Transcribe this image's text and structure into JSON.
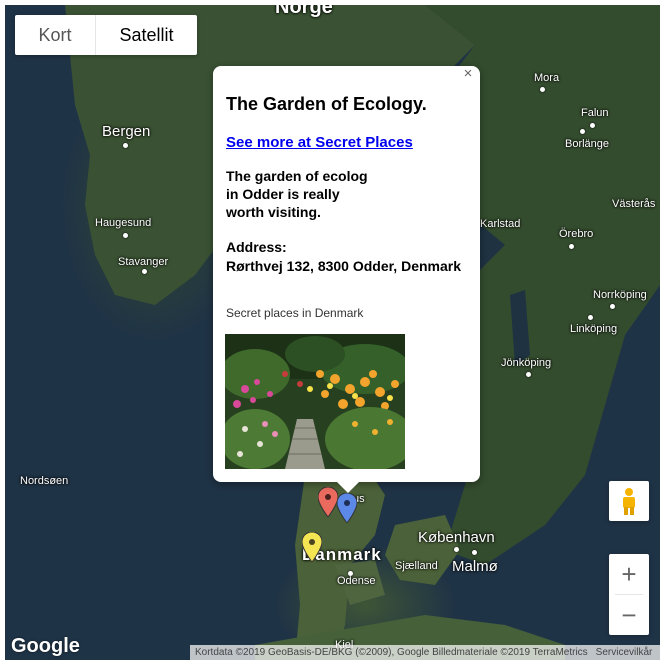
{
  "map_type": {
    "kort_label": "Kort",
    "satellite_label": "Satellit",
    "selected": "Satellit"
  },
  "map_labels": {
    "norge": "Norge",
    "bergen": "Bergen",
    "haugesund": "Haugesund",
    "stavanger": "Stavanger",
    "nordsoen": "Nordsøen",
    "mora": "Mora",
    "falun": "Falun",
    "borlange": "Borlänge",
    "vasteras": "Västerås",
    "karlstad": "Karlstad",
    "orebro": "Örebro",
    "norrkoping": "Norrköping",
    "linkoping": "Linköping",
    "jonkoping": "Jönköping",
    "aarhus": "us",
    "danmark": "Danmark",
    "kobenhavn": "København",
    "malmo": "Malmø",
    "sjaelland": "Sjælland",
    "odense": "Odense",
    "kiel": "Kiel"
  },
  "info_window": {
    "close_symbol": "×",
    "title": "The Garden of Ecology.",
    "link_text": "See more at Secret Places",
    "description": "The garden of ecolog\nin Odder is really\nworth visiting.",
    "address_label": "Address:",
    "address": "Rørthvej 132, 8300 Odder, Denmark",
    "caption": "Secret places in Denmark"
  },
  "markers": [
    {
      "color": "#ea6a5e"
    },
    {
      "color": "#5c88e8"
    },
    {
      "color": "#f4e553"
    }
  ],
  "controls": {
    "zoom_in": "+",
    "zoom_out": "−"
  },
  "footer": {
    "logo": "Google",
    "attribution": "Kortdata ©2019 GeoBasis-DE/BKG (©2009), Google Billedmateriale ©2019 TerraMetrics",
    "terms": "Servicevilkår"
  }
}
